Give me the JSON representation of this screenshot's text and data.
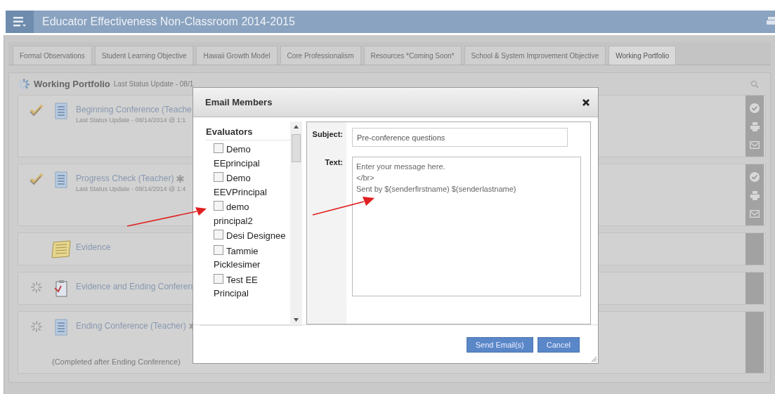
{
  "header": {
    "title": "Educator Effectiveness Non-Classroom 2014-2015"
  },
  "tabs": [
    {
      "label": "Formal Observations",
      "selected": false
    },
    {
      "label": "Student Learning Objective",
      "selected": false
    },
    {
      "label": "Hawaii Growth Model",
      "selected": false
    },
    {
      "label": "Core Professionalism",
      "selected": false
    },
    {
      "label": "Resources *Coming Soon*",
      "selected": false
    },
    {
      "label": "School & System Improvement Objective",
      "selected": false
    },
    {
      "label": "Working Portfolio",
      "selected": true
    }
  ],
  "portfolio": {
    "title": "Working Portfolio",
    "status": "Last Status Update - 08/1"
  },
  "items": [
    {
      "kind": "form",
      "completed": true,
      "title": "Beginning Conference (Teache",
      "required": false,
      "status": "Last Status Update - 08/14/2014 @ 1:1",
      "actions": true
    },
    {
      "kind": "form",
      "completed": true,
      "title": "Progress Check (Teacher)",
      "required": true,
      "status": "Last Status Update - 08/14/2014 @ 1:4",
      "actions": true
    },
    {
      "kind": "notes",
      "title": "Evidence",
      "required": false,
      "actions": false
    },
    {
      "kind": "clipboard",
      "completed": false,
      "title": "Evidence and Ending Conferen",
      "required": false,
      "actions": false
    },
    {
      "kind": "form",
      "completed": false,
      "title": "Ending Conference (Teacher)",
      "required": true,
      "note": "(Completed after Ending Conference)",
      "actions": false
    }
  ],
  "dialog": {
    "title": "Email Members",
    "list_heading": "Evaluators",
    "members": [
      {
        "name": "Demo EEprincipal",
        "checked": false
      },
      {
        "name": "Demo EEVPrincipal",
        "checked": false
      },
      {
        "name": "demo principal2",
        "checked": false
      },
      {
        "name": "Desi Designee",
        "checked": false
      },
      {
        "name": "Tammie Picklesimer",
        "checked": false
      },
      {
        "name": "Test EE Principal",
        "checked": false
      }
    ],
    "subject_label": "Subject:",
    "subject": "Pre-conference questions",
    "text_label": "Text:",
    "text": "Enter your message here.\n</br>\nSent by $(senderfirstname) $(senderlastname)",
    "buttons": [
      "Send Email(s)",
      "Cancel"
    ]
  }
}
